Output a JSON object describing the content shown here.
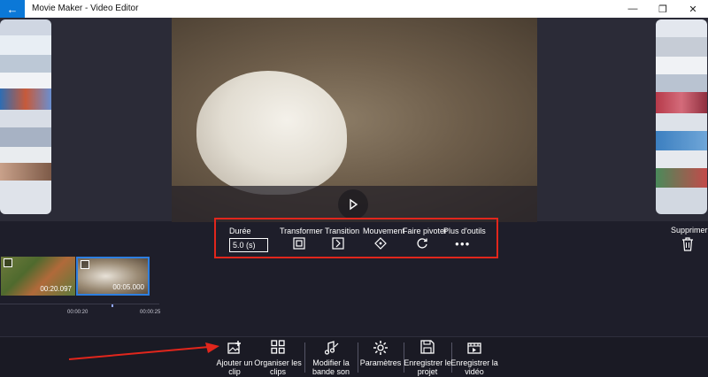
{
  "window": {
    "title": "Movie Maker - Video Editor",
    "back_icon": "arrow-left-icon",
    "minimize_glyph": "—",
    "maximize_glyph": "❐",
    "close_glyph": "✕"
  },
  "tools": {
    "duration_label": "Durée",
    "duration_value": "5.0 (s)",
    "transform_label": "Transformer",
    "transition_label": "Transition",
    "movement_label": "Mouvement",
    "rotate_label": "Faire pivoter",
    "more_label": "Plus d'outils",
    "more_glyph": "●●●"
  },
  "delete_label": "Supprimer",
  "timeline": {
    "clips": [
      {
        "duration": "00:20.097"
      },
      {
        "duration": "00:05.000"
      }
    ],
    "ticks": [
      "00:00:20",
      "00:00:25"
    ]
  },
  "bottom_bar": {
    "add_clip": "Ajouter un clip",
    "arrange_clips": "Organiser les clips",
    "edit_sound": "Modifier la bande son",
    "settings": "Paramètres",
    "save_project": "Enregistrer le projet",
    "save_video": "Enregistrer la vidéo"
  },
  "colors": {
    "accent": "#0b78d7",
    "highlight_border": "#e1261c",
    "selected_clip_border": "#2e7fe0",
    "background": "#1e1e2a"
  }
}
